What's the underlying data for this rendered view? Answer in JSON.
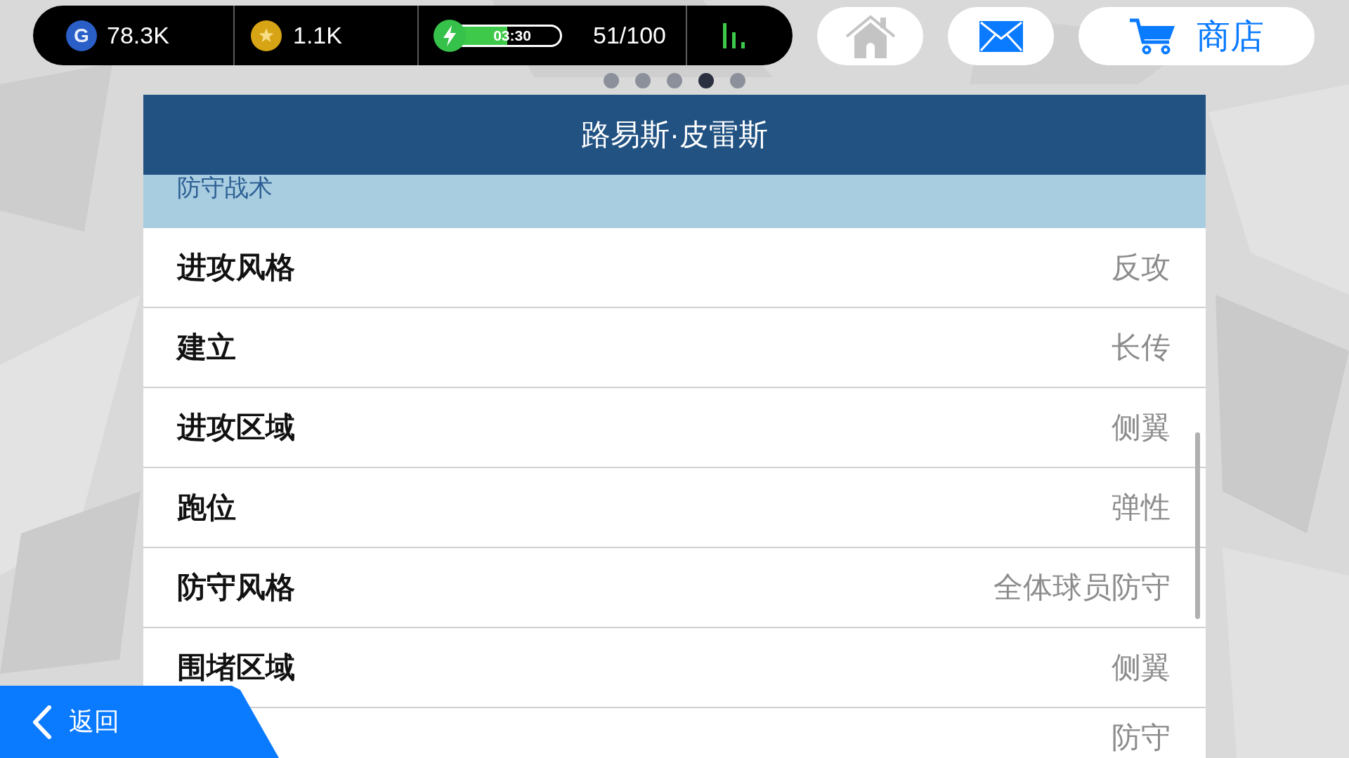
{
  "status_bar": {
    "currencies": [
      {
        "kind": "g",
        "symbol": "G",
        "amount": "78.3K"
      },
      {
        "kind": "star",
        "amount": "1.1K"
      }
    ],
    "energy": {
      "timer": "03:30",
      "level": 0.51,
      "count": "51/100"
    }
  },
  "nav_buttons": [
    {
      "kind": "home"
    },
    {
      "kind": "mail"
    },
    {
      "kind": "shop",
      "label": "商店"
    }
  ],
  "page_dots": [
    {
      "selected": false
    },
    {
      "selected": false
    },
    {
      "selected": false
    },
    {
      "selected": true
    },
    {
      "selected": false
    }
  ],
  "panel": {
    "title": "路易斯·皮雷斯",
    "section": "防守战术",
    "rows": [
      {
        "label": "进攻风格",
        "value": "反攻"
      },
      {
        "label": "建立",
        "value": "长传"
      },
      {
        "label": "进攻区域",
        "value": "侧翼"
      },
      {
        "label": "跑位",
        "value": "弹性"
      },
      {
        "label": "防守风格",
        "value": "全体球员防守"
      },
      {
        "label": "围堵区域",
        "value": "侧翼"
      },
      {
        "value": "防守"
      }
    ]
  },
  "back_button": {
    "label": "返回"
  }
}
